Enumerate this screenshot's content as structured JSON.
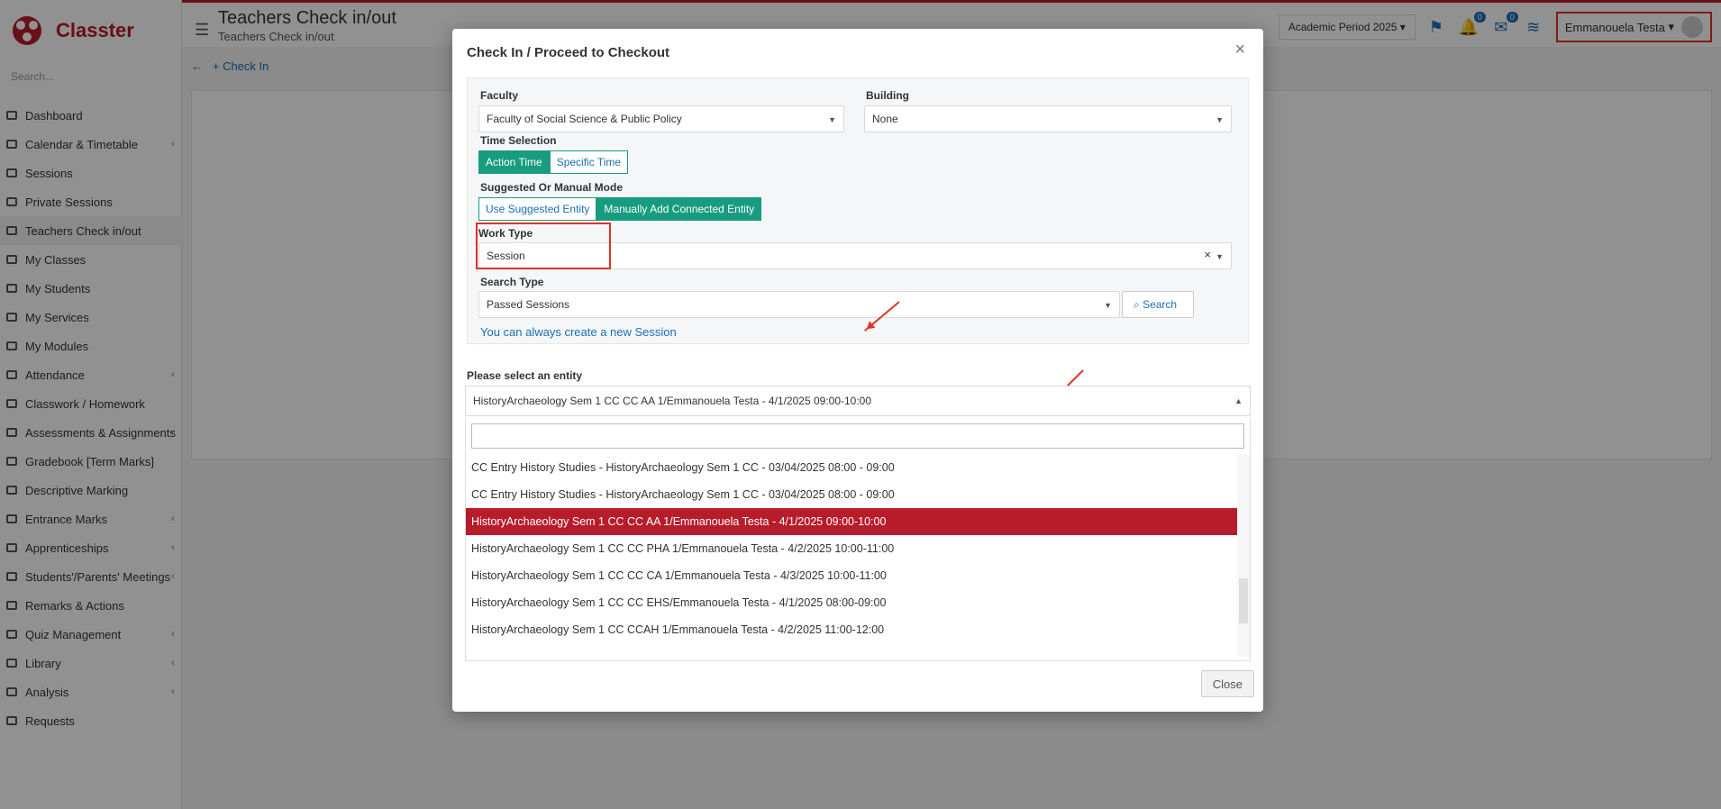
{
  "app": {
    "name": "Classter",
    "search_placeholder": "Search..."
  },
  "sidebar": {
    "items": [
      {
        "label": "Dashboard",
        "icon": "monitor-icon",
        "chev": false
      },
      {
        "label": "Calendar & Timetable",
        "icon": "calendar-icon",
        "chev": true
      },
      {
        "label": "Sessions",
        "icon": "sessions-icon",
        "chev": false
      },
      {
        "label": "Private Sessions",
        "icon": "private-sessions-icon",
        "chev": false
      },
      {
        "label": "Teachers Check in/out",
        "icon": "check-icon",
        "chev": false,
        "active": true
      },
      {
        "label": "My Classes",
        "icon": "classes-icon",
        "chev": false
      },
      {
        "label": "My Students",
        "icon": "students-icon",
        "chev": false
      },
      {
        "label": "My Services",
        "icon": "services-icon",
        "chev": false
      },
      {
        "label": "My Modules",
        "icon": "modules-icon",
        "chev": false
      },
      {
        "label": "Attendance",
        "icon": "attendance-icon",
        "chev": true
      },
      {
        "label": "Classwork / Homework",
        "icon": "classwork-icon",
        "chev": false
      },
      {
        "label": "Assessments & Assignments",
        "icon": "assessments-icon",
        "chev": true
      },
      {
        "label": "Gradebook [Term Marks]",
        "icon": "gradebook-icon",
        "chev": false
      },
      {
        "label": "Descriptive Marking",
        "icon": "descriptive-icon",
        "chev": false
      },
      {
        "label": "Entrance Marks",
        "icon": "entrance-icon",
        "chev": true
      },
      {
        "label": "Apprenticeships",
        "icon": "apprenticeships-icon",
        "chev": true
      },
      {
        "label": "Students'/Parents' Meetings",
        "icon": "meetings-icon",
        "chev": true
      },
      {
        "label": "Remarks & Actions",
        "icon": "remarks-icon",
        "chev": false
      },
      {
        "label": "Quiz Management",
        "icon": "quiz-icon",
        "chev": true
      },
      {
        "label": "Library",
        "icon": "library-icon",
        "chev": true
      },
      {
        "label": "Analysis",
        "icon": "analysis-icon",
        "chev": true
      },
      {
        "label": "Requests",
        "icon": "requests-icon",
        "chev": false
      }
    ]
  },
  "header": {
    "title": "Teachers Check in/out",
    "breadcrumb": "Teachers Check in/out",
    "period": "Academic Period 2025",
    "notif_count": "0",
    "mail_count": "0",
    "user": "Emmanouela Testa"
  },
  "subbar": {
    "check_in": "Check In"
  },
  "modal": {
    "title": "Check In / Proceed to Checkout",
    "faculty_label": "Faculty",
    "faculty_value": "Faculty of Social Science & Public Policy",
    "building_label": "Building",
    "building_value": "None",
    "time_label": "Time Selection",
    "time_opts": [
      "Action Time",
      "Specific Time"
    ],
    "mode_label": "Suggested Or Manual Mode",
    "mode_opts": [
      "Use Suggested Entity",
      "Manually Add Connected Entity"
    ],
    "work_label": "Work Type",
    "work_value": "Session",
    "search_type_label": "Search Type",
    "search_type_value": "Passed Sessions",
    "search_btn": "Search",
    "create_link": "You can always create a new Session",
    "entity_label": "Please select an entity",
    "entity_value": "HistoryArchaeology Sem 1 CC CC AA 1/Emmanouela Testa - 4/1/2025 09:00-10:00",
    "options": [
      "CC Entry History Studies - HistoryArchaeology Sem 1 CC - 03/04/2025 08:00 - 09:00",
      "CC Entry History Studies - HistoryArchaeology Sem 1 CC - 03/04/2025 08:00 - 09:00",
      "HistoryArchaeology Sem 1 CC CC AA 1/Emmanouela Testa - 4/1/2025 09:00-10:00",
      "HistoryArchaeology Sem 1 CC CC PHA 1/Emmanouela Testa - 4/2/2025 10:00-11:00",
      "HistoryArchaeology Sem 1 CC CC CA 1/Emmanouela Testa - 4/3/2025 10:00-11:00",
      "HistoryArchaeology Sem 1 CC CC EHS/Emmanouela Testa - 4/1/2025 08:00-09:00",
      "HistoryArchaeology Sem 1 CC CCAH 1/Emmanouela Testa - 4/2/2025 11:00-12:00"
    ],
    "close_btn": "Close"
  }
}
